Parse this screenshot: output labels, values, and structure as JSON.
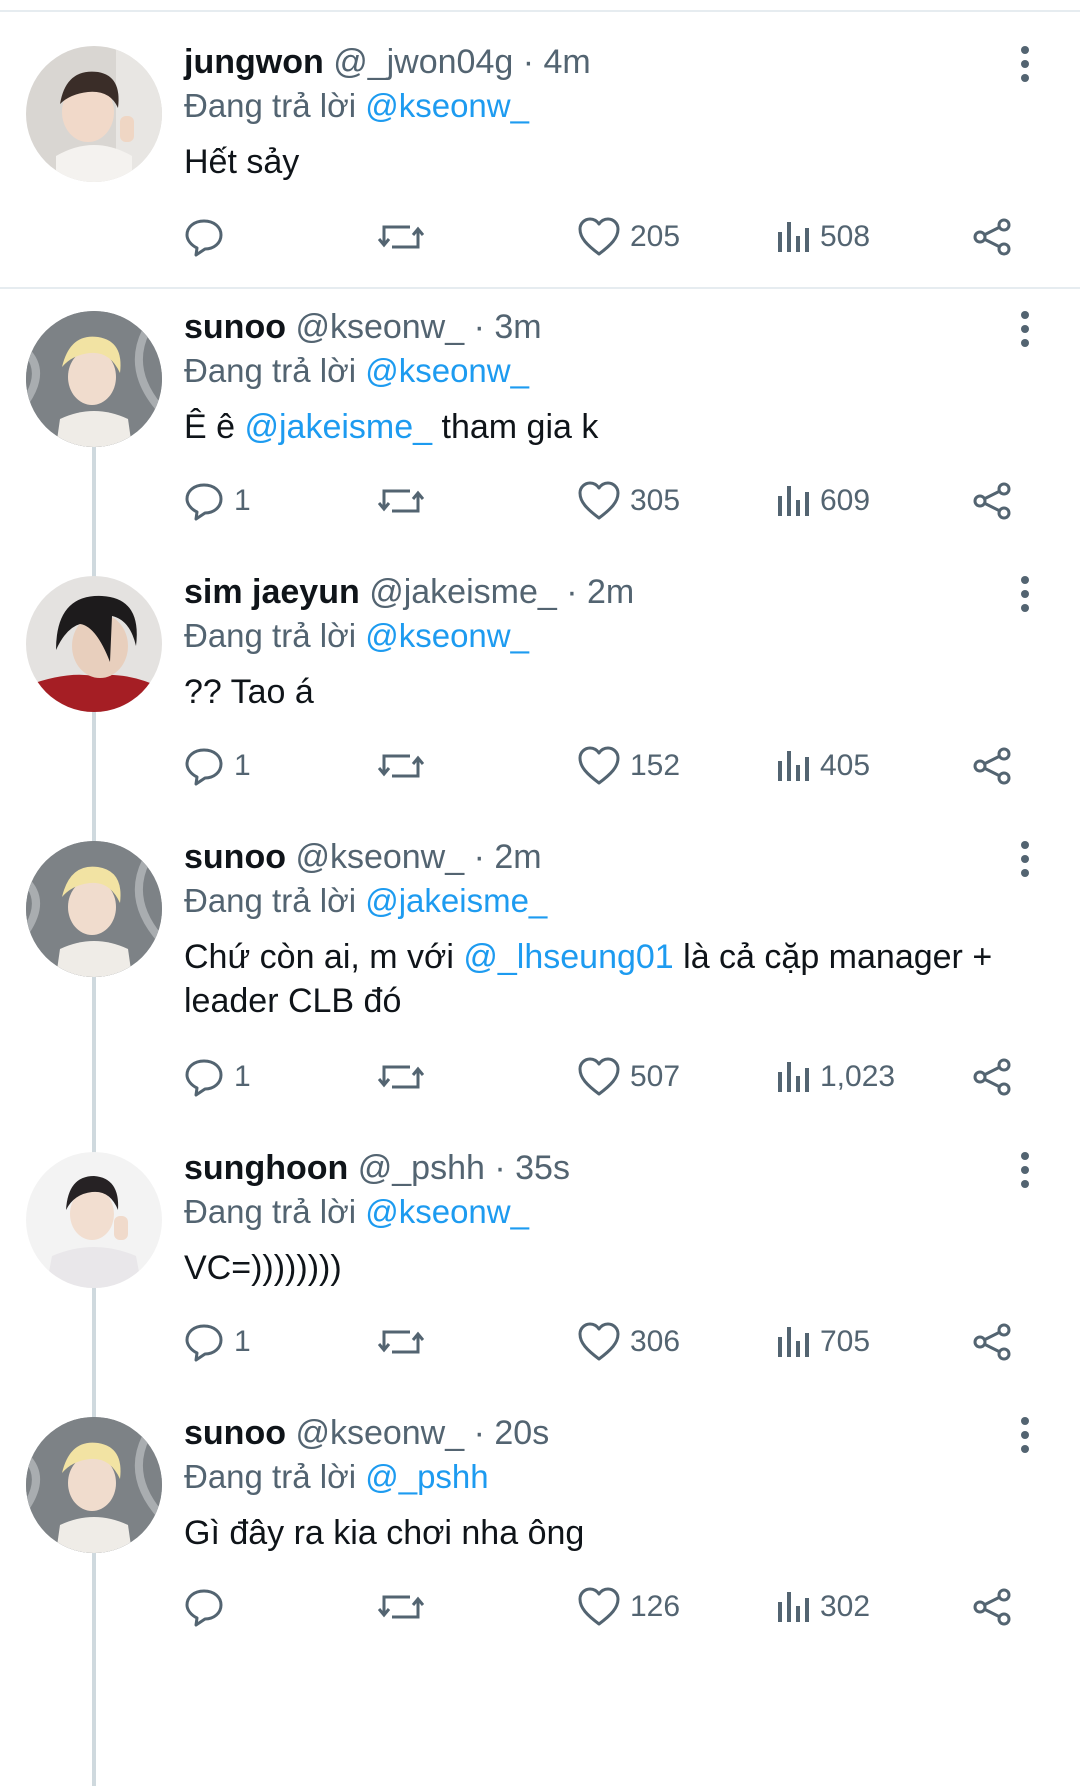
{
  "reply_prefix": "Đang trả lời",
  "tweets": [
    {
      "name": "jungwon",
      "handle": "@_jwon04g",
      "time": "· 4m",
      "reply_to": "@kseonw_",
      "text": "Hết sảy",
      "replies": "",
      "likes": "205",
      "views": "508"
    },
    {
      "name": "sunoo",
      "handle": "@kseonw_",
      "time": "· 3m",
      "reply_to": "@kseonw_",
      "text_parts": [
        "Ê ê ",
        "@jakeisme_",
        " tham gia k"
      ],
      "replies": "1",
      "likes": "305",
      "views": "609"
    },
    {
      "name": "sim jaeyun",
      "handle": "@jakeisme_",
      "time": "· 2m",
      "reply_to": "@kseonw_",
      "text": "?? Tao á",
      "replies": "1",
      "likes": "152",
      "views": "405"
    },
    {
      "name": "sunoo",
      "handle": "@kseonw_",
      "time": "· 2m",
      "reply_to": "@jakeisme_",
      "text_parts": [
        "Chứ còn ai, m với ",
        "@_lhseung01",
        " là cả cặp manager + leader CLB đó"
      ],
      "replies": "1",
      "likes": "507",
      "views": "1,023"
    },
    {
      "name": "sunghoon",
      "handle": "@_pshh",
      "time": "· 35s",
      "reply_to": "@kseonw_",
      "text": "VC=))))))))",
      "replies": "1",
      "likes": "306",
      "views": "705"
    },
    {
      "name": "sunoo",
      "handle": "@kseonw_",
      "time": "· 20s",
      "reply_to": "@_pshh",
      "text": "Gì đây ra kia chơi nha ông",
      "replies": "",
      "likes": "126",
      "views": "302"
    }
  ],
  "colors": {
    "mention": "#1d9bf0",
    "secondary": "#536471",
    "divider": "#e6ecf0"
  }
}
